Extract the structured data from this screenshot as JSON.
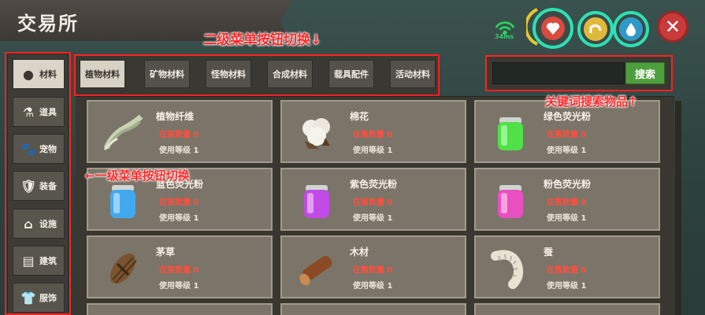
{
  "title": "交易所",
  "annotations": {
    "sub_menu": "二级菜单按钮切换↓",
    "search": "关键词搜索物品↑",
    "main_menu": "←一级菜单按钮切换"
  },
  "hud": {
    "ping": "34ms",
    "close_symbol": "✕"
  },
  "sidebar": {
    "items": [
      {
        "label": "材料",
        "icon": "●"
      },
      {
        "label": "道具",
        "icon": "⚗"
      },
      {
        "label": "宠物",
        "icon": "🐾"
      },
      {
        "label": "装备",
        "icon": "🛡"
      },
      {
        "label": "设施",
        "icon": "⌂"
      },
      {
        "label": "建筑",
        "icon": "▤"
      },
      {
        "label": "服饰",
        "icon": "👕"
      }
    ]
  },
  "subtabs": [
    "植物材料",
    "矿物材料",
    "怪物材料",
    "合成材料",
    "载具配件",
    "活动材料"
  ],
  "search": {
    "placeholder": "",
    "button": "搜索"
  },
  "cards": [
    {
      "name": "植物纤维",
      "sale": "在售数量 0",
      "level": "使用等级 1",
      "icon": "fiber"
    },
    {
      "name": "棉花",
      "sale": "在售数量 0",
      "level": "使用等级 1",
      "icon": "cotton"
    },
    {
      "name": "绿色荧光粉",
      "sale": "在售数量 0",
      "level": "使用等级 1",
      "icon": "jar-green"
    },
    {
      "name": "蓝色荧光粉",
      "sale": "在售数量 0",
      "level": "使用等级 1",
      "icon": "jar-blue"
    },
    {
      "name": "紫色荧光粉",
      "sale": "在售数量 0",
      "level": "使用等级 1",
      "icon": "jar-purple"
    },
    {
      "name": "粉色荧光粉",
      "sale": "在售数量 0",
      "level": "使用等级 1",
      "icon": "jar-pink"
    },
    {
      "name": "茅草",
      "sale": "在售数量 0",
      "level": "使用等级 1",
      "icon": "thatch"
    },
    {
      "name": "木材",
      "sale": "在售数量 0",
      "level": "使用等级 1",
      "icon": "log"
    },
    {
      "name": "蚕",
      "sale": "在售数量 0",
      "level": "使用等级 1",
      "icon": "silkworm"
    }
  ]
}
